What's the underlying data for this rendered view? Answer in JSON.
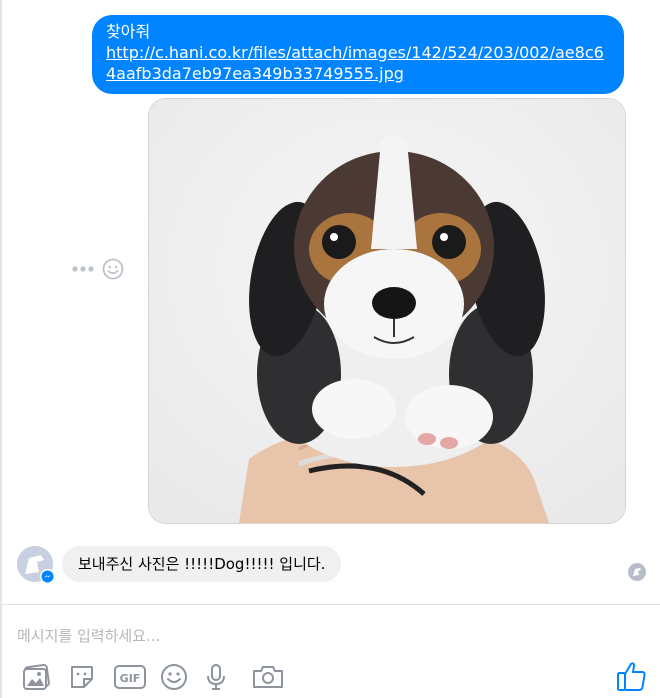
{
  "thread": {
    "outgoing": {
      "text": "찾아줘",
      "link": "http://c.hani.co.kr/files/attach/images/142/524/203/002/ae8c64aafb3da7eb97ea349b33749555.jpg"
    },
    "incoming": {
      "text": "보내주신 사진은 !!!!!Dog!!!!! 입니다."
    }
  },
  "composer": {
    "placeholder": "메시지를 입력하세요..."
  },
  "toolbar": {
    "gif_label": "GIF"
  },
  "colors": {
    "accent": "#0084ff",
    "incoming_bubble": "#f1f0f0",
    "icon": "#8d949e"
  }
}
